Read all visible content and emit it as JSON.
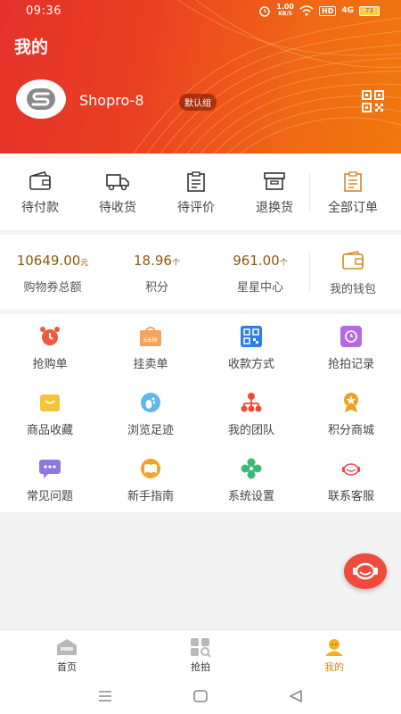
{
  "status_bar": {
    "time": "09:36",
    "net_speed_value": "1.00",
    "net_speed_unit": "KB/S",
    "hd": "HD",
    "signal": "4G",
    "battery": "73"
  },
  "header": {
    "title": "我的",
    "username": "Shopro-8",
    "group_badge": "默认组",
    "colors": {
      "gradient_start": "#e4322a",
      "gradient_end": "#f1780e"
    }
  },
  "orders": [
    {
      "label": "待付款",
      "icon": "wallet-icon"
    },
    {
      "label": "待收货",
      "icon": "truck-icon"
    },
    {
      "label": "待评价",
      "icon": "clipboard-icon"
    },
    {
      "label": "退换货",
      "icon": "box-icon"
    },
    {
      "label": "全部订单",
      "icon": "order-list-icon"
    }
  ],
  "wallet": {
    "voucher": {
      "value": "10649.00",
      "unit": "元",
      "label": "购物券总额"
    },
    "points": {
      "value": "18.96",
      "unit": "个",
      "label": "积分"
    },
    "stars": {
      "value": "961.00",
      "unit": "个",
      "label": "星星中心"
    },
    "my_wallet": {
      "label": "我的钱包",
      "icon": "wallet-icon"
    }
  },
  "grid": [
    {
      "label": "抢购单",
      "icon": "alarm-clock-icon"
    },
    {
      "label": "挂卖单",
      "icon": "sale-bag-icon"
    },
    {
      "label": "收款方式",
      "icon": "qr-code-icon"
    },
    {
      "label": "抢拍记录",
      "icon": "clock-record-icon"
    },
    {
      "label": "商品收藏",
      "icon": "favorite-box-icon"
    },
    {
      "label": "浏览足迹",
      "icon": "footprint-icon"
    },
    {
      "label": "我的团队",
      "icon": "team-tree-icon"
    },
    {
      "label": "积分商城",
      "icon": "medal-icon"
    },
    {
      "label": "常见问题",
      "icon": "chat-bubble-icon"
    },
    {
      "label": "新手指南",
      "icon": "book-icon"
    },
    {
      "label": "系统设置",
      "icon": "flower-gear-icon"
    },
    {
      "label": "联系客服",
      "icon": "headset-icon"
    }
  ],
  "tabbar": [
    {
      "label": "首页",
      "icon": "home-icon",
      "active": false
    },
    {
      "label": "抢拍",
      "icon": "grid-search-icon",
      "active": false
    },
    {
      "label": "我的",
      "icon": "user-icon",
      "active": true
    }
  ]
}
